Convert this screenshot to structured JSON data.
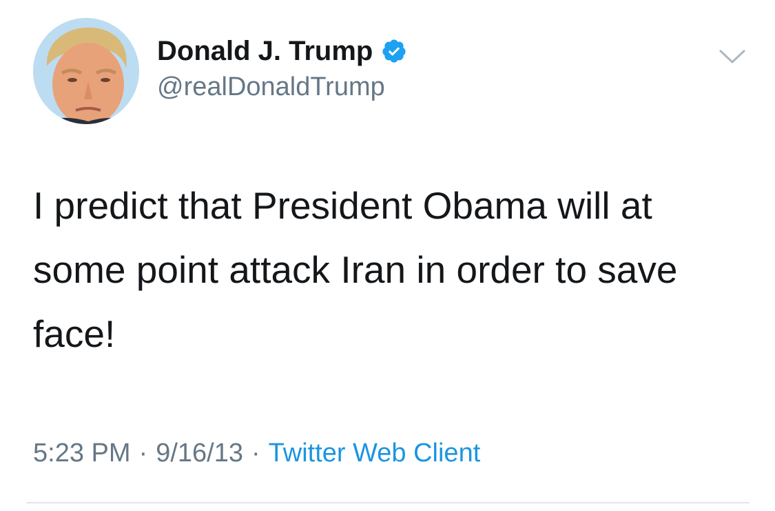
{
  "author": {
    "name": "Donald J. Trump",
    "handle": "@realDonaldTrump",
    "verified": true
  },
  "tweet": {
    "text": "I predict that President Obama will at some point attack Iran in order to save face!",
    "time": "5:23 PM",
    "date": "9/16/13",
    "separator": "·",
    "source": "Twitter Web Client"
  },
  "colors": {
    "name": "#14171a",
    "secondary": "#657786",
    "link": "#1b95e0",
    "verified": "#1da1f2",
    "divider": "#e1e8ed"
  },
  "icons": {
    "verified": "verified-badge-icon",
    "menu": "chevron-down-icon"
  }
}
